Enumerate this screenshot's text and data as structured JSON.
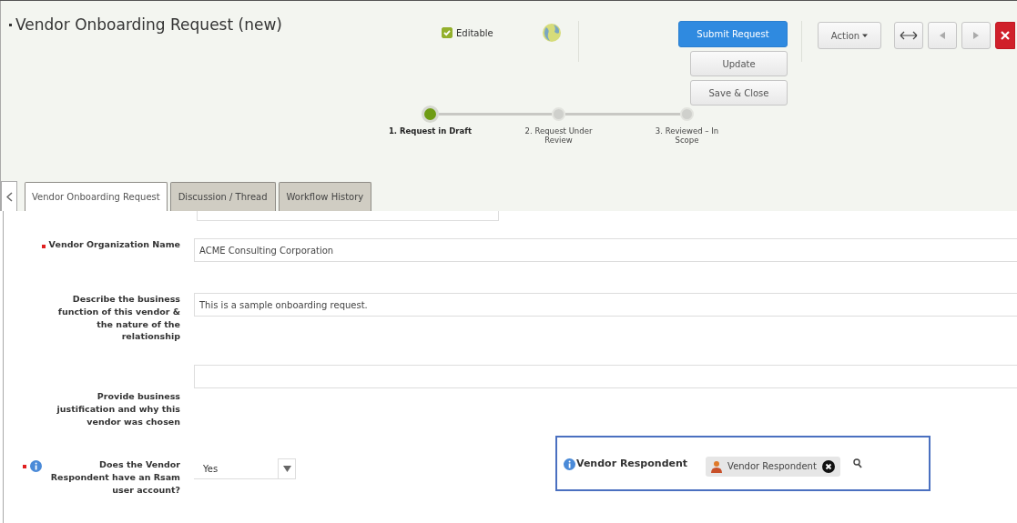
{
  "header": {
    "title": "Vendor Onboarding Request (new)",
    "editable": {
      "label": "Editable",
      "checked": true
    },
    "buttons": [
      "Submit Request",
      "Update",
      "Save & Close"
    ],
    "action_menu": "Action"
  },
  "steps": [
    {
      "label": "1. Request in Draft",
      "selected": true
    },
    {
      "label": "2. Request Under Review",
      "selected": false
    },
    {
      "label": "3. Reviewed – In Scope",
      "selected": false
    }
  ],
  "tabs": [
    {
      "label": "Vendor Onboarding Request",
      "selected": true
    },
    {
      "label": "Discussion / Thread",
      "selected": false
    },
    {
      "label": "Workflow History",
      "selected": false
    }
  ],
  "form": [
    {
      "kind": "text",
      "label": "Vendor Organization Name",
      "required": true,
      "info": false,
      "value": "ACME Consulting Corporation"
    },
    {
      "kind": "text",
      "label": "Describe the business function of this vendor & the nature of the relationship",
      "required": false,
      "info": false,
      "value": "This is a sample onboarding request."
    },
    {
      "kind": "text",
      "label": "Provide business justification and why this vendor was chosen",
      "required": false,
      "info": false
    },
    {
      "kind": "select",
      "label": "Does the Vendor Respondent have an Rsam user account?",
      "required": true,
      "info": true,
      "value": "Yes"
    }
  ],
  "respondent": {
    "label": "Vendor Respondent",
    "info": true,
    "value": "Vendor Respondent"
  }
}
